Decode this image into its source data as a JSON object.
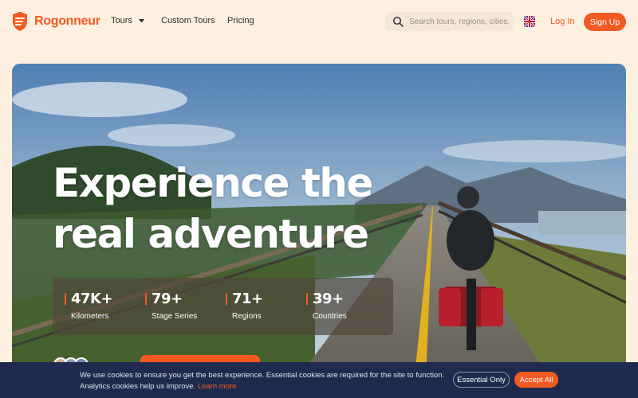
{
  "header": {
    "brand": "Rogonneur",
    "nav": [
      {
        "label": "Tours",
        "has_dropdown": true
      },
      {
        "label": "Custom Tours"
      },
      {
        "label": "Pricing"
      }
    ],
    "search": {
      "placeholder": "Search tours, regions, cities..."
    },
    "language_icon": "uk-flag-icon",
    "login_label": "Log In",
    "signup_label": "Sign Up"
  },
  "hero": {
    "headline": "Experience the real adventure",
    "stats": [
      {
        "value": "47K+",
        "label": "Kilometers"
      },
      {
        "value": "79+",
        "label": "Stage Series"
      },
      {
        "value": "71+",
        "label": "Regions"
      },
      {
        "value": "39+",
        "label": "Countries"
      }
    ]
  },
  "cookie_banner": {
    "text": "We use cookies to ensure you get the best experience. Essential cookies are required for the site to function. Analytics cookies help us improve.",
    "learn_more": "Learn more",
    "essential_label": "Essential Only",
    "accept_label": "Accept All"
  },
  "colors": {
    "accent": "#f15a22",
    "page_bg": "#fdf0e1",
    "cookie_bg": "#1f2b4e"
  }
}
